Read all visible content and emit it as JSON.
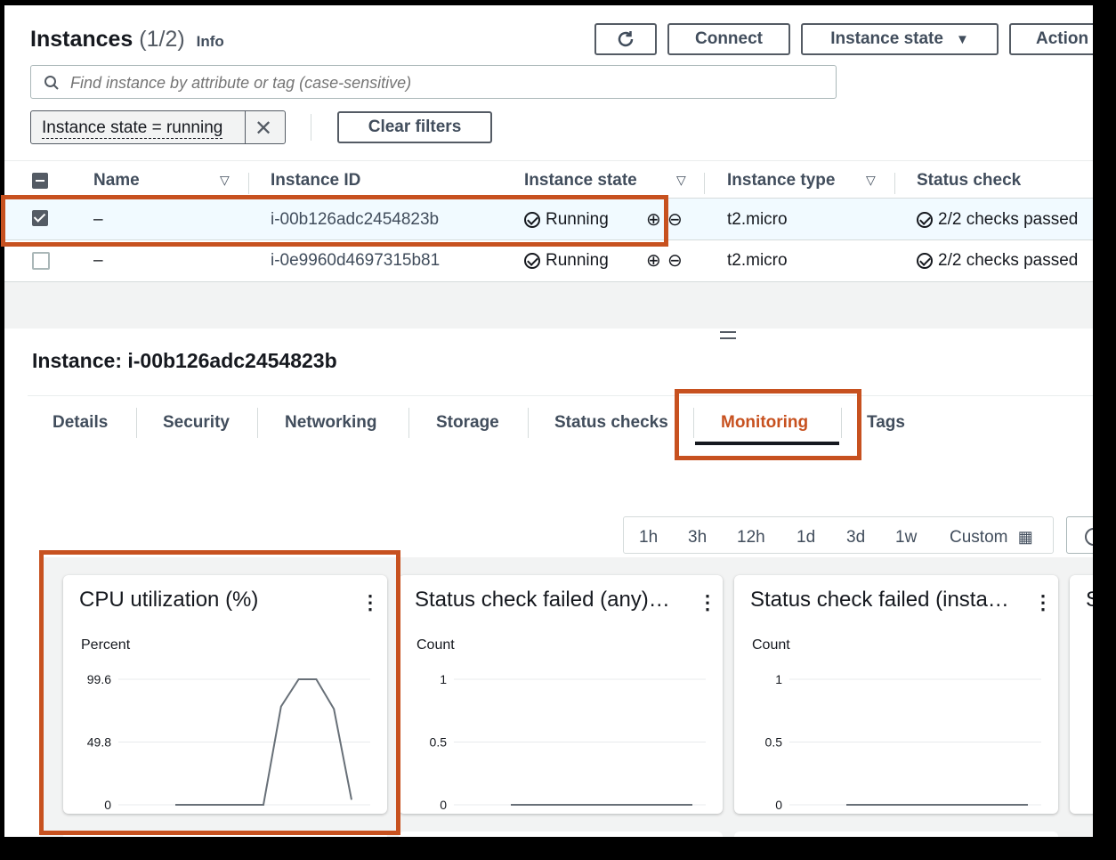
{
  "header": {
    "title": "Instances",
    "count": "(1/2)",
    "info": "Info",
    "buttons": {
      "refresh_icon": "refresh-icon",
      "connect": "Connect",
      "instance_state": "Instance state",
      "actions": "Action"
    }
  },
  "search": {
    "placeholder": "Find instance by attribute or tag (case-sensitive)"
  },
  "filters": {
    "chip": "Instance state = running",
    "clear": "Clear filters"
  },
  "table": {
    "columns": [
      "Name",
      "Instance ID",
      "Instance state",
      "Instance type",
      "Status check"
    ],
    "rows": [
      {
        "name": "–",
        "id": "i-00b126adc2454823b",
        "state": "Running",
        "type": "t2.micro",
        "status": "2/2 checks passed",
        "selected": true
      },
      {
        "name": "–",
        "id": "i-0e9960d4697315b81",
        "state": "Running",
        "type": "t2.micro",
        "status": "2/2 checks passed",
        "selected": false
      }
    ]
  },
  "detail": {
    "title": "Instance: i-00b126adc2454823b",
    "tabs": [
      "Details",
      "Security",
      "Networking",
      "Storage",
      "Status checks",
      "Monitoring",
      "Tags"
    ],
    "active_tab": "Monitoring",
    "ranges": [
      "1h",
      "3h",
      "12h",
      "1d",
      "3d",
      "1w",
      "Custom"
    ]
  },
  "colors": {
    "highlight": "#c7511f",
    "link": "#414d5c"
  },
  "chart_data": [
    {
      "type": "line",
      "title": "CPU utilization (%)",
      "ylabel": "Percent",
      "yticks": [
        "99.6",
        "49.8",
        "0"
      ],
      "ylim": [
        0,
        99.6
      ],
      "x": [
        1,
        2,
        3,
        4,
        5,
        6,
        7,
        8,
        9,
        10,
        11,
        12
      ],
      "values": [
        0,
        0,
        0,
        0,
        0,
        0,
        78,
        99.6,
        99.6,
        76,
        4
      ]
    },
    {
      "type": "line",
      "title": "Status check failed (any)…",
      "ylabel": "Count",
      "yticks": [
        "1",
        "0.5",
        "0"
      ],
      "ylim": [
        0,
        1
      ],
      "values": [
        0,
        0,
        0,
        0,
        0,
        0
      ]
    },
    {
      "type": "line",
      "title": "Status check failed (insta…",
      "ylabel": "Count",
      "yticks": [
        "1",
        "0.5",
        "0"
      ],
      "ylim": [
        0,
        1
      ],
      "values": [
        0,
        0,
        0,
        0,
        0,
        0
      ]
    }
  ]
}
